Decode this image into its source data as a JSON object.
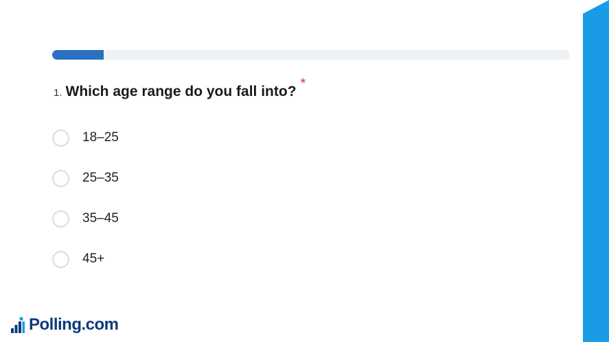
{
  "survey": {
    "progress_fraction": 0.1,
    "question": {
      "number": "1.",
      "text": "Which age range do you fall into?",
      "required_mark": "*"
    },
    "options": [
      {
        "label": "18–25",
        "selected": false
      },
      {
        "label": "25–35",
        "selected": false
      },
      {
        "label": "35–45",
        "selected": false
      },
      {
        "label": "45+",
        "selected": false
      }
    ]
  },
  "brand": {
    "name": "Polling.com",
    "logo_icon": "bar-chart-figure-icon"
  },
  "colors": {
    "accent": "#1a9be6",
    "progress_fill": "#2b6fbf",
    "progress_track": "#eef1f5",
    "required": "#e0352b",
    "brand_text": "#0e3a7d"
  }
}
